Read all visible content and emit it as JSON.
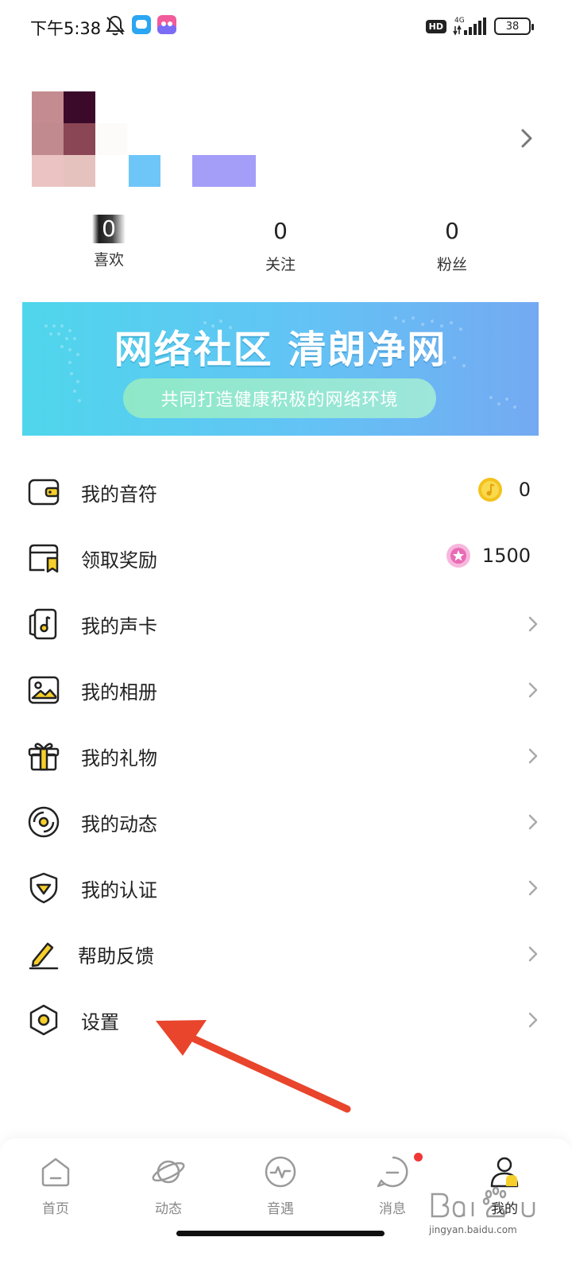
{
  "status_bar": {
    "time": "下午5:38",
    "hd": "HD",
    "network": "4G",
    "battery": "38"
  },
  "profile": {
    "arrow_icon": "chevron-right-icon"
  },
  "stats": [
    {
      "value": "0",
      "label": "喜欢"
    },
    {
      "value": "0",
      "label": "关注"
    },
    {
      "value": "0",
      "label": "粉丝"
    }
  ],
  "banner": {
    "title": "网络社区 清朗净网",
    "subtitle": "共同打造健康积极的网络环境"
  },
  "menu": [
    {
      "label": "我的音符",
      "icon": "wallet-icon",
      "value": "0",
      "badge": "gold-coin-icon"
    },
    {
      "label": "领取奖励",
      "icon": "reward-icon",
      "value": "1500",
      "badge": "pink-star-coin-icon"
    },
    {
      "label": "我的声卡",
      "icon": "music-card-icon"
    },
    {
      "label": "我的相册",
      "icon": "album-icon"
    },
    {
      "label": "我的礼物",
      "icon": "gift-icon"
    },
    {
      "label": "我的动态",
      "icon": "disc-icon"
    },
    {
      "label": "我的认证",
      "icon": "shield-icon"
    },
    {
      "label": "帮助反馈",
      "icon": "pencil-icon"
    },
    {
      "label": "设置",
      "icon": "settings-icon"
    }
  ],
  "bottom_nav": [
    {
      "label": "首页",
      "icon": "home-icon",
      "active": false
    },
    {
      "label": "动态",
      "icon": "planet-icon",
      "active": false
    },
    {
      "label": "音遇",
      "icon": "pulse-icon",
      "active": false
    },
    {
      "label": "消息",
      "icon": "message-icon",
      "active": false,
      "has_dot": true
    },
    {
      "label": "我的",
      "icon": "profile-icon",
      "active": true
    }
  ],
  "watermark": {
    "text": "jingyan.baidu.com"
  },
  "colors": {
    "accent_yellow": "#f6cf2a",
    "notification_red": "#f03737",
    "banner_start": "#4fd6ec",
    "banner_end": "#74a9f2",
    "annotation_arrow": "#e8452c"
  }
}
